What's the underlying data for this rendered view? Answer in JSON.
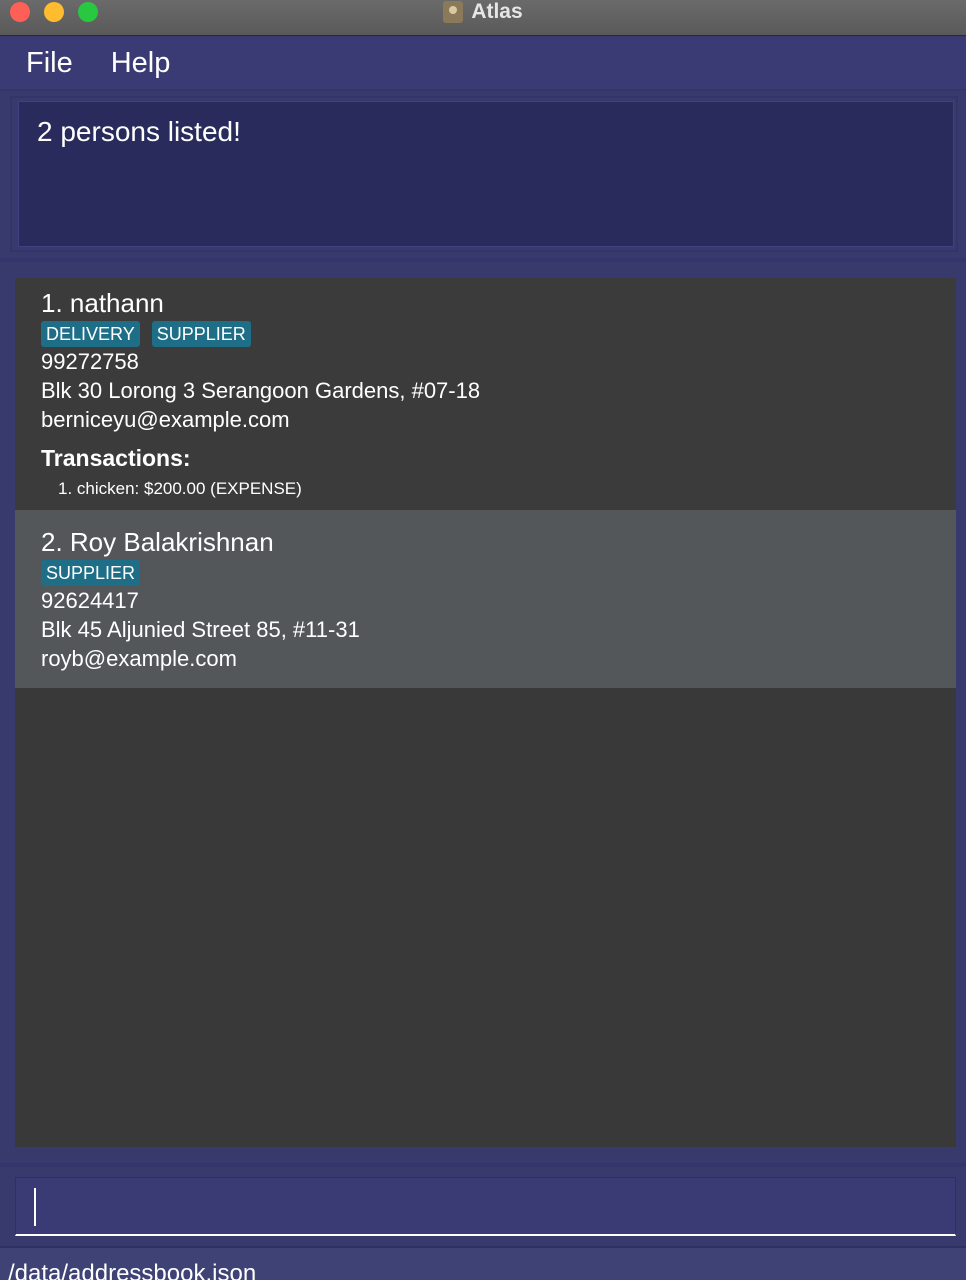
{
  "window": {
    "title": "Atlas",
    "icon": "contacts-book-icon"
  },
  "menu": {
    "file_label": "File",
    "help_label": "Help"
  },
  "result": {
    "message": "2 persons listed!"
  },
  "persons": [
    {
      "name": "1. nathann",
      "tags": [
        "DELIVERY",
        "SUPPLIER"
      ],
      "phone": "99272758",
      "address": "Blk 30 Lorong 3 Serangoon Gardens, #07-18",
      "email": "berniceyu@example.com",
      "transactions_heading": "Transactions:",
      "transactions": [
        "1. chicken: $200.00 (EXPENSE)"
      ]
    },
    {
      "name": "2. Roy Balakrishnan",
      "tags": [
        "SUPPLIER"
      ],
      "phone": "92624417",
      "address": "Blk 45 Aljunied Street 85, #11-31",
      "email": "royb@example.com"
    }
  ],
  "command": {
    "value": ""
  },
  "status": {
    "path": "/data/addressbook.json"
  },
  "colors": {
    "tag": "#1f6e87",
    "background": "#383a6e",
    "list": "#393939",
    "selected_card": "#53575a"
  }
}
